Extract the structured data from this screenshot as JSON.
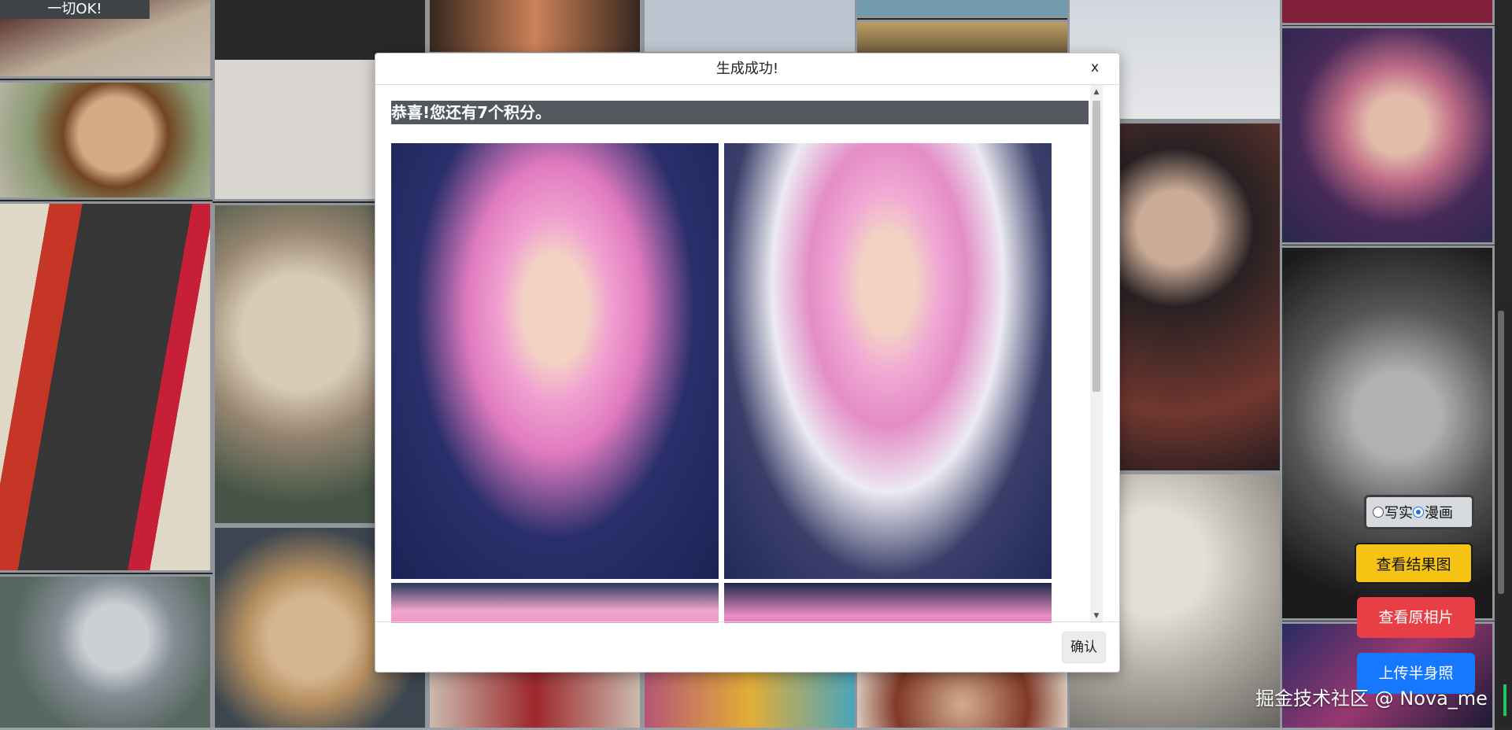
{
  "toast": {
    "text": "一切OK!"
  },
  "modal": {
    "title": "生成成功!",
    "close_label": "x",
    "message": "恭喜!您还有7个积分。",
    "confirm_label": "确认",
    "scroll_up_icon": "▲",
    "scroll_down_icon": "▼"
  },
  "controls": {
    "style_options": [
      {
        "label": "写实",
        "selected": false
      },
      {
        "label": "漫画",
        "selected": true
      }
    ],
    "view_result_label": "查看结果图",
    "view_original_label": "查看原相片",
    "upload_label": "上传半身照"
  },
  "watermark": {
    "text": "掘金技术社区 @ Nova_me"
  },
  "colors": {
    "view_result_bg": "#f5c313",
    "view_original_bg": "#e83f46",
    "upload_bg": "#1677ff",
    "message_bar_bg": "#53585e"
  }
}
